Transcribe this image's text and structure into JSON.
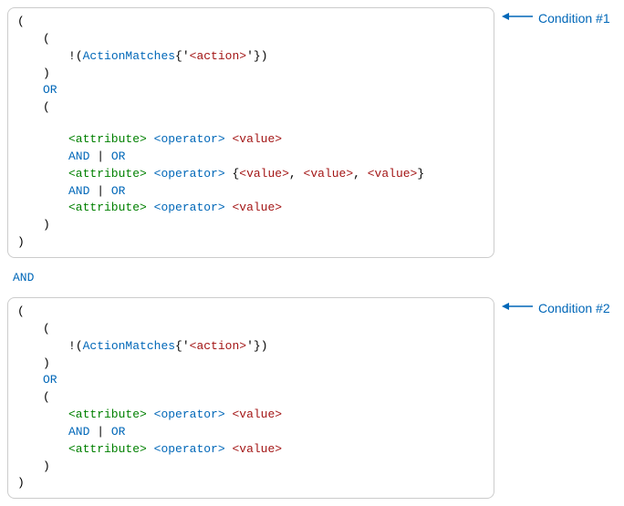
{
  "tokens": {
    "openParen": "(",
    "closeParen": ")",
    "not": "!",
    "actionMatches": "ActionMatches",
    "openTempl": "{'",
    "closeTempl": "'}",
    "actionPH": "<action>",
    "attributePH": "<attribute>",
    "operatorPH": "<operator>",
    "valuePH": "<value>",
    "or": "OR",
    "and": "AND",
    "pipe": "|",
    "openBrace": "{",
    "closeBrace": "}",
    "comma": ","
  },
  "between": "AND",
  "labels": {
    "condition1": "Condition #1",
    "condition2": "Condition #2"
  }
}
